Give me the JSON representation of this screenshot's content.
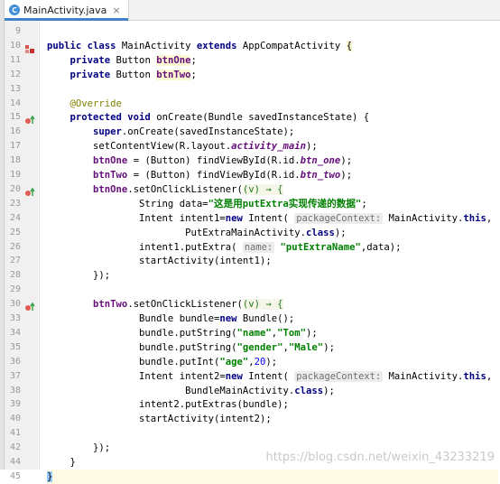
{
  "tab": {
    "icon": "java-class-icon",
    "icon_letter": "C",
    "label": "MainActivity.java",
    "close": "×"
  },
  "lines": [
    {
      "n": "9",
      "html": ""
    },
    {
      "n": "10",
      "mark": "class",
      "html": "<span class='kw'>public class</span> MainActivity <span class='kw'>extends</span> AppCompatActivity <span class='hl'>{</span>"
    },
    {
      "n": "11",
      "html": "    <span class='kw'>private</span> Button <span class='fld hl'>btnOne</span>;"
    },
    {
      "n": "12",
      "html": "    <span class='kw'>private</span> Button <span class='fld hl'>btnTwo</span>;"
    },
    {
      "n": "13",
      "html": ""
    },
    {
      "n": "14",
      "html": "    <span class='ann'>@Override</span>"
    },
    {
      "n": "15",
      "mark": "override",
      "html": "    <span class='kw'>protected void</span> onCreate(Bundle savedInstanceState) {"
    },
    {
      "n": "16",
      "html": "        <span class='kw'>super</span>.onCreate(savedInstanceState);"
    },
    {
      "n": "17",
      "html": "        setContentView(R.layout.<span class='fldi'>activity_main</span>);"
    },
    {
      "n": "18",
      "html": "        <span class='fld'>btnOne</span> = (Button) findViewById(R.id.<span class='fldi'>btn_one</span>);"
    },
    {
      "n": "19",
      "html": "        <span class='fld'>btnTwo</span> = (Button) findViewById(R.id.<span class='fldi'>btn_two</span>);"
    },
    {
      "n": "20",
      "mark": "override",
      "html": "        <span class='fld'>btnOne</span>.setOnClickListener(<span class='lam'>(v) → {</span>"
    },
    {
      "n": "23",
      "html": "                String data=<span class='str'>\"这是用putExtra实现传递的数据\"</span>;"
    },
    {
      "n": "24",
      "html": "                Intent intent1=<span class='kw'>new</span> Intent( <span class='hint'>packageContext:</span> MainActivity.<span class='kw'>this</span>,"
    },
    {
      "n": "25",
      "html": "                        PutExtraMainActivity.<span class='kw'>class</span>);"
    },
    {
      "n": "26",
      "html": "                intent1.putExtra( <span class='hint'>name:</span> <span class='str'>\"putExtraName\"</span>,data);"
    },
    {
      "n": "27",
      "html": "                startActivity(intent1);"
    },
    {
      "n": "28",
      "html": "        });"
    },
    {
      "n": "29",
      "html": ""
    },
    {
      "n": "30",
      "mark": "override",
      "html": "        <span class='fld'>btnTwo</span>.setOnClickListener(<span class='lam'>(v) → {</span>"
    },
    {
      "n": "33",
      "html": "                Bundle bundle=<span class='kw'>new</span> Bundle();"
    },
    {
      "n": "34",
      "html": "                bundle.putString(<span class='str'>\"name\"</span>,<span class='str'>\"Tom\"</span>);"
    },
    {
      "n": "35",
      "html": "                bundle.putString(<span class='str'>\"gender\"</span>,<span class='str'>\"Male\"</span>);"
    },
    {
      "n": "36",
      "html": "                bundle.putInt(<span class='str'>\"age\"</span>,<span class='num'>20</span>);"
    },
    {
      "n": "37",
      "html": "                Intent intent2=<span class='kw'>new</span> Intent( <span class='hint'>packageContext:</span> MainActivity.<span class='kw'>this</span>,"
    },
    {
      "n": "38",
      "html": "                        BundleMainActivity.<span class='kw'>class</span>);"
    },
    {
      "n": "39",
      "html": "                intent2.putExtras(bundle);"
    },
    {
      "n": "40",
      "html": "                startActivity(intent2);"
    },
    {
      "n": "41",
      "html": ""
    },
    {
      "n": "42",
      "html": "        });"
    },
    {
      "n": "44",
      "html": "    }"
    },
    {
      "n": "45",
      "caret": true,
      "html": "<span class='brace'>}</span>"
    }
  ],
  "watermark": "https://blog.csdn.net/weixin_43233219",
  "colors": {
    "keyword": "#000080",
    "field": "#660e7a",
    "string": "#008000",
    "number": "#0000ff",
    "annotation": "#808000",
    "accent": "#4083c9"
  }
}
